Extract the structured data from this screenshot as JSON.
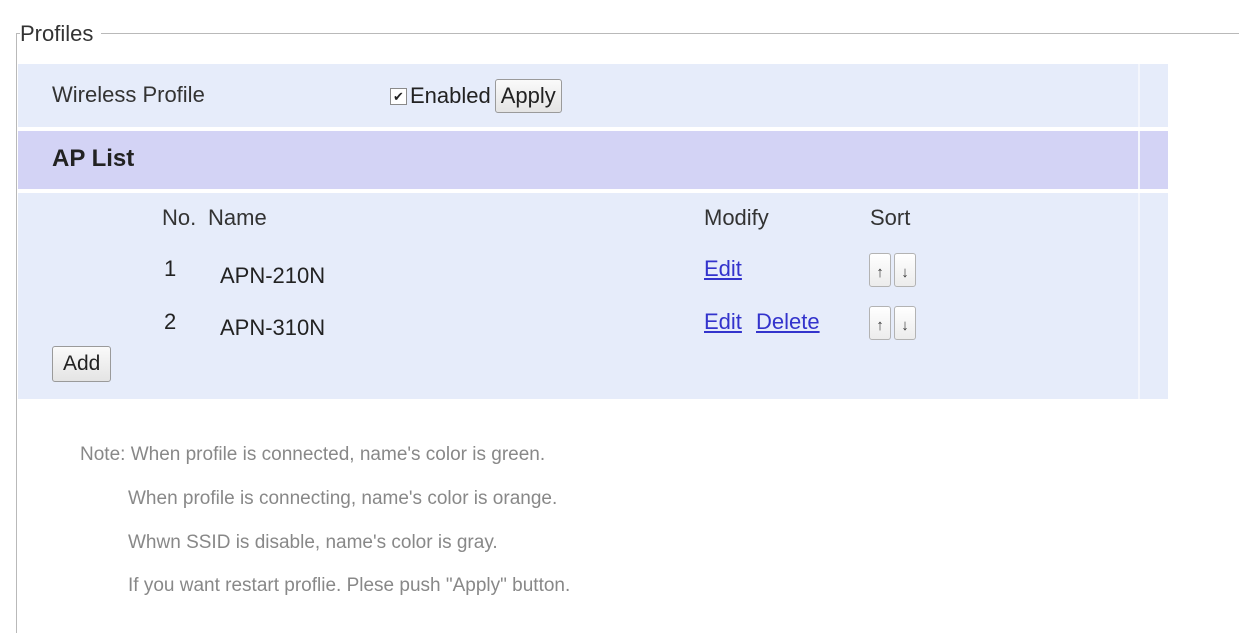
{
  "fieldset": {
    "legend": "Profiles"
  },
  "wireless_profile": {
    "label": "Wireless Profile",
    "checkbox_checked": true,
    "enabled_label": "Enabled",
    "apply_label": "Apply"
  },
  "ap_list": {
    "title": "AP List",
    "columns": {
      "no": "No.",
      "name": "Name",
      "modify": "Modify",
      "sort": "Sort"
    },
    "rows": [
      {
        "no": "1",
        "name": "APN-210N",
        "edit": "Edit",
        "delete": ""
      },
      {
        "no": "2",
        "name": "APN-310N",
        "edit": "Edit",
        "delete": "Delete"
      }
    ],
    "sort_up": "↑",
    "sort_down": "↓",
    "add_label": "Add"
  },
  "notes": [
    "Note: When profile is connected, name's color is green.",
    "When profile is connecting, name's color is orange.",
    "Whwn SSID is disable, name's color is gray.",
    "If you want restart proflie. Plese push \"Apply\" button."
  ],
  "colors": {
    "row_bg": "#e6ecfa",
    "header_bg": "#d3d3f5",
    "link": "#3333cc",
    "note_text": "#888888"
  }
}
